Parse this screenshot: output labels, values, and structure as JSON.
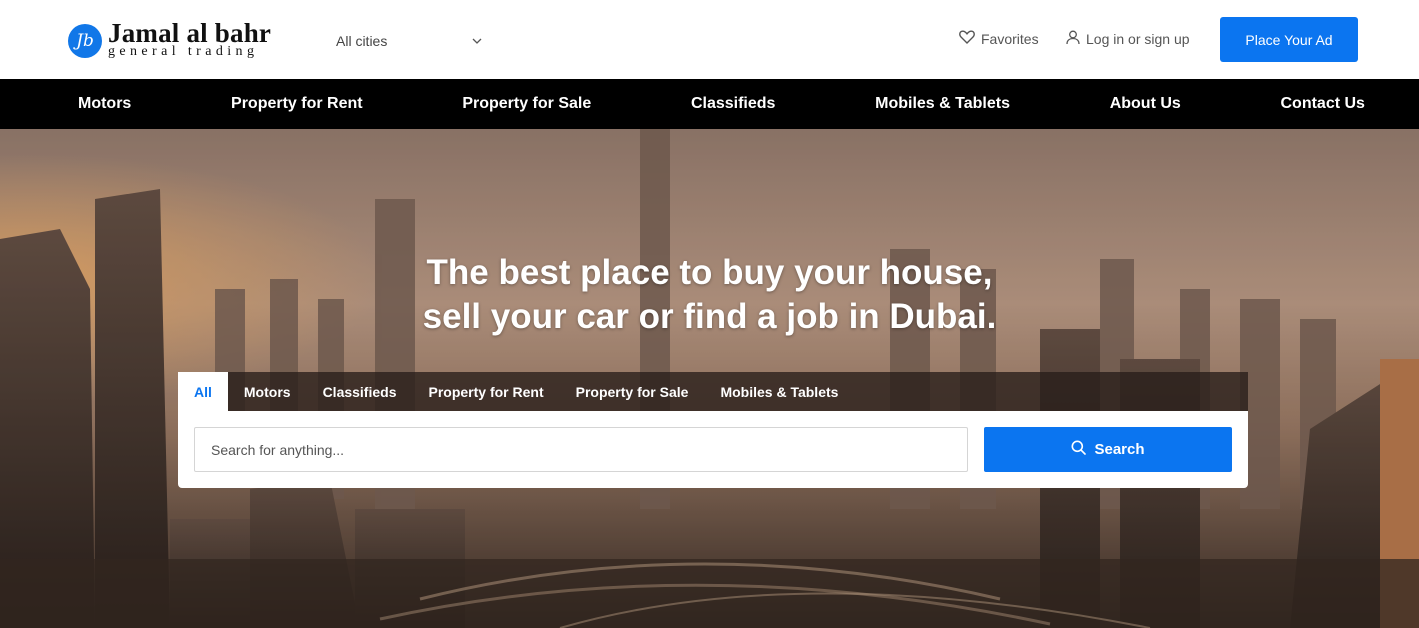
{
  "brand": {
    "name": "Jamal al bahr",
    "subtitle": "general trading",
    "monogram": "Jb",
    "accent_color": "#0b75f0"
  },
  "header": {
    "city_select": {
      "selected": "All cities",
      "icon": "chevron-down-icon"
    },
    "favorites": {
      "label": "Favorites",
      "icon": "heart-icon"
    },
    "login": {
      "label": "Log in or sign up",
      "icon": "user-icon"
    },
    "place_ad": {
      "label": "Place Your Ad"
    }
  },
  "nav": {
    "items": [
      {
        "label": "Motors"
      },
      {
        "label": "Property for Rent"
      },
      {
        "label": "Property for Sale"
      },
      {
        "label": "Classifieds"
      },
      {
        "label": "Mobiles & Tablets"
      },
      {
        "label": "About Us"
      },
      {
        "label": "Contact Us"
      }
    ]
  },
  "hero": {
    "title_line1": "The best place to buy your house,",
    "title_line2": "sell your car or find a job in Dubai.",
    "tabs": [
      {
        "label": "All",
        "active": true
      },
      {
        "label": "Motors"
      },
      {
        "label": "Classifieds"
      },
      {
        "label": "Property for Rent"
      },
      {
        "label": "Property for Sale"
      },
      {
        "label": "Mobiles & Tablets"
      }
    ],
    "search": {
      "placeholder": "Search for anything...",
      "value": "",
      "button_label": "Search",
      "button_icon": "search-icon"
    }
  }
}
